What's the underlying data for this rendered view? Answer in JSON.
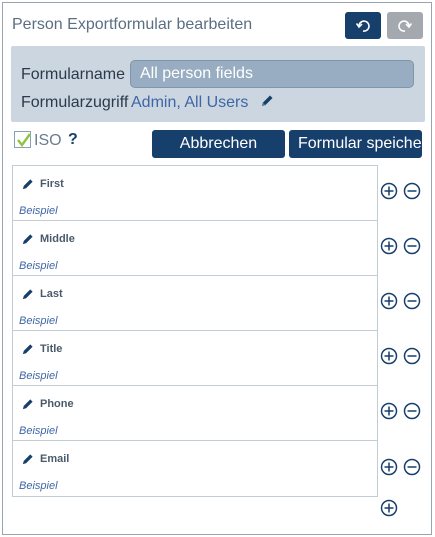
{
  "header": {
    "title": "Person Exportformular bearbeiten"
  },
  "settings": {
    "name_label": "Formularname",
    "name_value": "All person fields",
    "access_label": "Formularzugriff",
    "access_value": "Admin, All Users"
  },
  "options": {
    "iso_label": "ISO",
    "help": "?"
  },
  "actions": {
    "cancel_label": "Abbrechen",
    "save_label": "Formular speichern"
  },
  "fields": [
    {
      "name": "First",
      "example": "Beispiel"
    },
    {
      "name": "Middle",
      "example": "Beispiel"
    },
    {
      "name": "Last",
      "example": "Beispiel"
    },
    {
      "name": "Title",
      "example": "Beispiel"
    },
    {
      "name": "Phone",
      "example": "Beispiel"
    },
    {
      "name": "Email",
      "example": "Beispiel"
    }
  ],
  "colors": {
    "primary": "#173f6b",
    "panel_bg": "#cbd6e1",
    "link": "#3f66a6",
    "disabled": "#a3a9af"
  }
}
